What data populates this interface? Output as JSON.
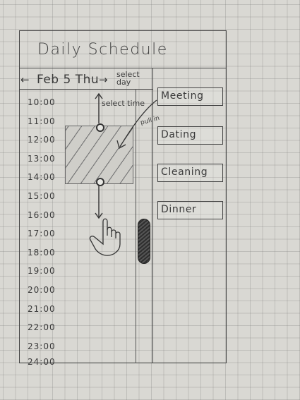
{
  "header": {
    "title": "Daily Schedule"
  },
  "nav": {
    "prev_icon": "←",
    "date": "Feb 5 Thu",
    "next_icon": "→",
    "hint": "select day"
  },
  "timeline": {
    "times": [
      "10:00",
      "11:00",
      "12:00",
      "13:00",
      "14:00",
      "15:00",
      "16:00",
      "17:00",
      "18:00",
      "19:00",
      "20:00",
      "21:00",
      "22:00",
      "23:00",
      "24:00"
    ]
  },
  "selection": {
    "note": "select time"
  },
  "events": {
    "hint": "pull in",
    "items": [
      {
        "label": "Meeting"
      },
      {
        "label": "Dating"
      },
      {
        "label": "Cleaning"
      },
      {
        "label": "Dinner"
      }
    ]
  }
}
